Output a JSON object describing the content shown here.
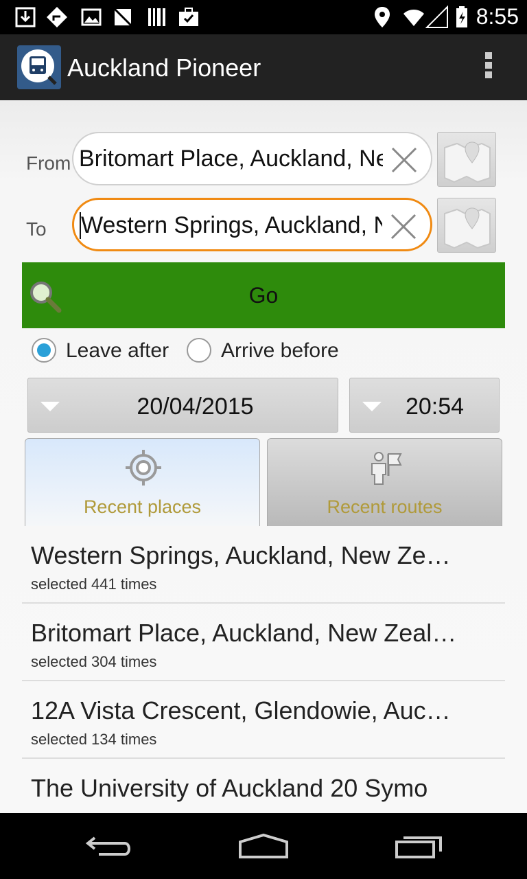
{
  "status_bar": {
    "time": "8:55"
  },
  "app": {
    "title": "Auckland Pioneer"
  },
  "form": {
    "from_label": "From",
    "from_value": "Britomart Place, Auckland, New Zealand",
    "to_label": "To",
    "to_value": "Western Springs, Auckland, New Zealand",
    "go_label": "Go"
  },
  "timing": {
    "options": [
      {
        "label": "Leave after",
        "selected": true
      },
      {
        "label": "Arrive before",
        "selected": false
      }
    ],
    "date": "20/04/2015",
    "time": "20:54"
  },
  "tabs": [
    {
      "label": "Recent places",
      "active": true,
      "icon": "target-icon"
    },
    {
      "label": "Recent routes",
      "active": false,
      "icon": "person-flag-icon"
    }
  ],
  "recent_places": [
    {
      "name": "Western Springs, Auckland, New Ze…",
      "count": "selected 441 times"
    },
    {
      "name": "Britomart Place, Auckland, New Zeal…",
      "count": "selected 304 times"
    },
    {
      "name": "12A Vista Crescent, Glendowie, Auc…",
      "count": "selected 134 times"
    },
    {
      "name": "The University of Auckland 20 Symo",
      "count": ""
    }
  ],
  "colors": {
    "go_green": "#2e8b0c",
    "focus_orange": "#f08a12",
    "radio_blue": "#2aa0d8",
    "tab_label": "#b09a3a"
  }
}
